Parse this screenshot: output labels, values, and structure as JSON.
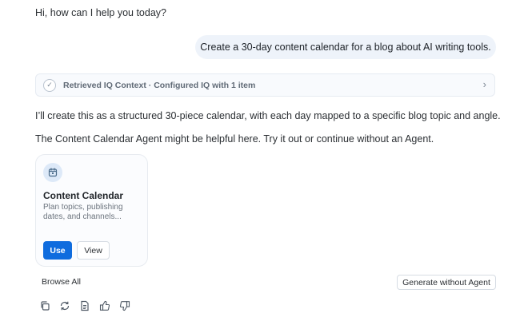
{
  "chat": {
    "greeting": "Hi, how can I help you today?",
    "user_message": "Create a 30-day content calendar for a blog about AI writing tools.",
    "context": {
      "label": "Retrieved IQ Context · Configured IQ with 1 item",
      "icon": "check-icon",
      "chevron": "chevron-right-icon"
    },
    "response_line_1": "I’ll create this as a structured 30-piece calendar, with each day mapped to a specific blog topic and angle.",
    "response_line_2": "The Content Calendar Agent might be helpful here. Try it out or continue without an Agent."
  },
  "agent_card": {
    "icon": "calendar-icon",
    "title": "Content Calendar",
    "description_line_1": "Plan topics, publishing",
    "description_line_2": "dates, and channels...",
    "use_label": "Use",
    "view_label": "View",
    "accent_color": "#0f6cde",
    "icon_bg": "#dde9f8"
  },
  "footer": {
    "browse_all_label": "Browse All",
    "generate_label": "Generate without Agent",
    "action_icons": [
      "copy-icon",
      "regenerate-icon",
      "document-icon",
      "thumbs-up-icon",
      "thumbs-down-icon"
    ]
  }
}
